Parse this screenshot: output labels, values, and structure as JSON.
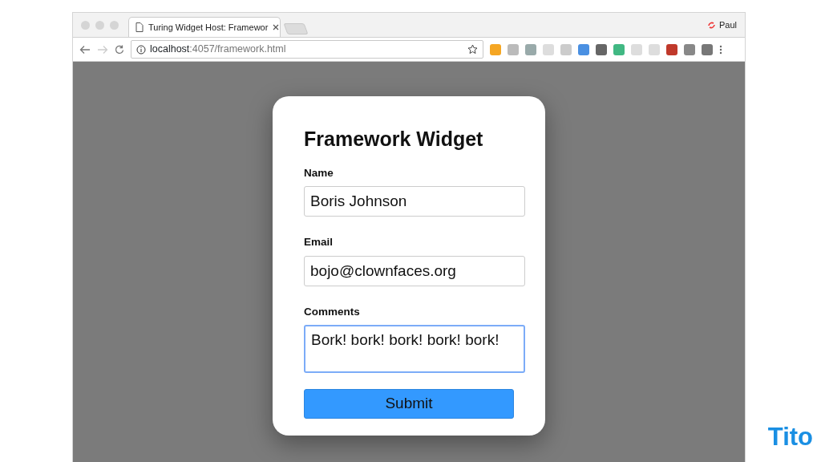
{
  "browser": {
    "tab": {
      "title": "Turing Widget Host: Framewor",
      "selected": true
    },
    "profile": "Paul",
    "address": {
      "host": "localhost",
      "path": ":4057/framework.html"
    }
  },
  "widget": {
    "title": "Framework Widget",
    "fields": [
      {
        "kind": "input",
        "label": "Name",
        "value": "Boris Johnson",
        "focused": false
      },
      {
        "kind": "input",
        "label": "Email",
        "value": "bojo@clownfaces.org",
        "focused": false
      },
      {
        "kind": "textarea",
        "label": "Comments",
        "value": "Bork! bork! bork! bork! bork!",
        "focused": true
      }
    ],
    "submit": "Submit"
  },
  "logo": "Tito"
}
